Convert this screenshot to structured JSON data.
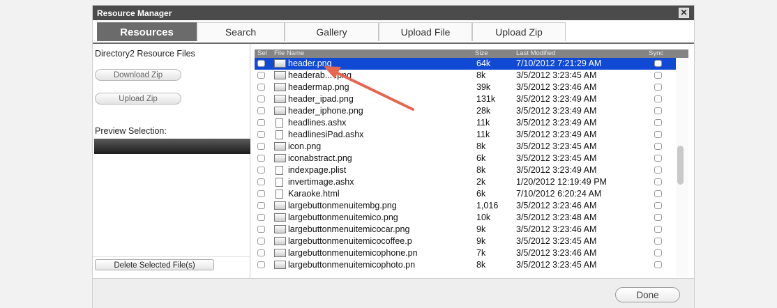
{
  "window": {
    "title": "Resource Manager",
    "close_label": "✕"
  },
  "tabs": [
    "Resources",
    "Search",
    "Gallery",
    "Upload File",
    "Upload Zip"
  ],
  "left": {
    "directory_label": "Directory2 Resource Files",
    "download_zip": "Download Zip",
    "upload_zip": "Upload Zip",
    "preview_label": "Preview Selection:",
    "delete_button": "Delete Selected File(s)"
  },
  "list_header": {
    "sel": "Sel",
    "name": "File Name",
    "size": "Size",
    "modified": "Last Modified",
    "sync": "Sync"
  },
  "files": [
    {
      "name": "header.png",
      "size": "64k",
      "modified": "7/10/2012 7:21:29 AM",
      "icon": "image-file-icon",
      "selected": true
    },
    {
      "name": "headerab... .png",
      "size": "8k",
      "modified": "3/5/2012 3:23:45 AM",
      "icon": "image-file-icon"
    },
    {
      "name": "headermap.png",
      "size": "39k",
      "modified": "3/5/2012 3:23:46 AM",
      "icon": "image-file-icon"
    },
    {
      "name": "header_ipad.png",
      "size": "131k",
      "modified": "3/5/2012 3:23:49 AM",
      "icon": "image-file-icon"
    },
    {
      "name": "header_iphone.png",
      "size": "28k",
      "modified": "3/5/2012 3:23:49 AM",
      "icon": "image-file-icon"
    },
    {
      "name": "headlines.ashx",
      "size": "11k",
      "modified": "3/5/2012 3:23:49 AM",
      "icon": "document-file-icon"
    },
    {
      "name": "headlinesiPad.ashx",
      "size": "11k",
      "modified": "3/5/2012 3:23:49 AM",
      "icon": "document-file-icon"
    },
    {
      "name": "icon.png",
      "size": "8k",
      "modified": "3/5/2012 3:23:45 AM",
      "icon": "image-file-icon"
    },
    {
      "name": "iconabstract.png",
      "size": "6k",
      "modified": "3/5/2012 3:23:45 AM",
      "icon": "image-file-icon"
    },
    {
      "name": "indexpage.plist",
      "size": "8k",
      "modified": "3/5/2012 3:23:49 AM",
      "icon": "document-file-icon"
    },
    {
      "name": "invertimage.ashx",
      "size": "2k",
      "modified": "1/20/2012 12:19:49 PM",
      "icon": "document-file-icon"
    },
    {
      "name": "Karaoke.html",
      "size": "6k",
      "modified": "7/10/2012 6:20:24 AM",
      "icon": "document-file-icon"
    },
    {
      "name": "largebuttonmenuitembg.png",
      "size": "1,016",
      "modified": "3/5/2012 3:23:46 AM",
      "icon": "image-file-icon"
    },
    {
      "name": "largebuttonmenuitemico.png",
      "size": "10k",
      "modified": "3/5/2012 3:23:48 AM",
      "icon": "image-file-icon"
    },
    {
      "name": "largebuttonmenuitemicocar.png",
      "size": "9k",
      "modified": "3/5/2012 3:23:46 AM",
      "icon": "image-file-icon"
    },
    {
      "name": "largebuttonmenuitemicocoffee.p",
      "size": "9k",
      "modified": "3/5/2012 3:23:45 AM",
      "icon": "image-file-icon"
    },
    {
      "name": "largebuttonmenuitemicophone.pn",
      "size": "7k",
      "modified": "3/5/2012 3:23:46 AM",
      "icon": "image-file-icon"
    },
    {
      "name": "largebuttonmenuitemicophoto.pn",
      "size": "8k",
      "modified": "3/5/2012 3:23:45 AM",
      "icon": "image-file-icon"
    }
  ],
  "footer": {
    "done_button": "Done"
  },
  "colors": {
    "selection": "#1049d4",
    "tab_active": "#6b6b6b",
    "annotation_arrow": "#e8654f",
    "titlebar": "#4b4b4b"
  }
}
